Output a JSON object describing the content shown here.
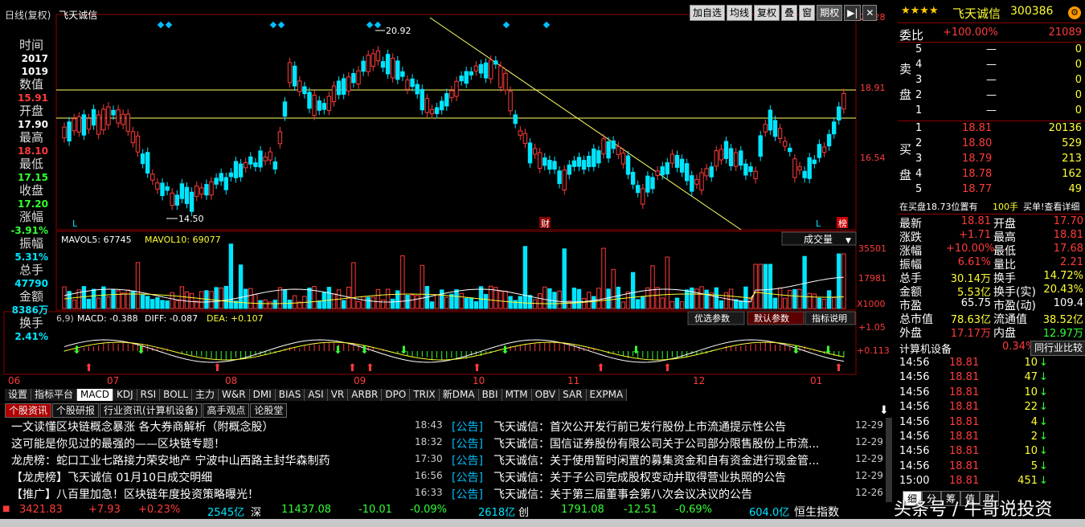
{
  "header": {
    "chart_title": "日线(复权)",
    "stock_name": "飞天诚信",
    "buttons": [
      "加自选",
      "均线",
      "复权",
      "叠",
      "窗"
    ],
    "period_label": "期权"
  },
  "price_axis": {
    "labels": [
      "21.28",
      "18.91",
      "16.54"
    ],
    "high_marker": "20.92",
    "low_marker": "14.50",
    "markers": [
      "L",
      "财",
      "L",
      "榜"
    ]
  },
  "volume": {
    "mavol5": "MAVOL5: 67745",
    "mavol10": "MAVOL10: 69077",
    "dropdown": "成交量",
    "axis": [
      "35501",
      "17981"
    ],
    "unit": "X1000"
  },
  "macd": {
    "params": "6,9)",
    "macd": "MACD: -0.388",
    "diff": "DIFF: -0.087",
    "dea": "DEA: +0.107",
    "axis": [
      "+1.05",
      "+0.113"
    ],
    "buttons": [
      "优选参数",
      "默认参数",
      "指标说明"
    ]
  },
  "months": [
    "06",
    "07",
    "08",
    "09",
    "10",
    "11",
    "12",
    "01"
  ],
  "left_panel": [
    {
      "label": "时间",
      "values": [
        "2017",
        "1019"
      ],
      "color": "#ffffff"
    },
    {
      "label": "数值",
      "values": [
        "15.91"
      ],
      "color": "#ff3b3b"
    },
    {
      "label": "开盘",
      "values": [
        "17.90"
      ],
      "color": "#ffffff"
    },
    {
      "label": "最高",
      "values": [
        "18.10"
      ],
      "color": "#ff3b3b"
    },
    {
      "label": "最低",
      "values": [
        "17.15"
      ],
      "color": "#33ff33"
    },
    {
      "label": "收盘",
      "values": [
        "17.20"
      ],
      "color": "#33ff33"
    },
    {
      "label": "涨幅",
      "values": [
        "-3.91%"
      ],
      "color": "#33ff33"
    },
    {
      "label": "振幅",
      "values": [
        "5.31%"
      ],
      "color": "#00e5ff"
    },
    {
      "label": "总手",
      "values": [
        "47790"
      ],
      "color": "#00e5ff"
    },
    {
      "label": "金额",
      "values": [
        "8386万"
      ],
      "color": "#00e5ff"
    },
    {
      "label": "换手",
      "values": [
        "2.41%"
      ],
      "color": "#00e5ff"
    }
  ],
  "right": {
    "stars": "★★★★",
    "name": "飞天诚信",
    "code": "300386",
    "weibi_label": "委比",
    "weibi": "+100.00%",
    "weicha": "21089",
    "sell_label": [
      "卖",
      "盘"
    ],
    "buy_label": [
      "买",
      "盘"
    ],
    "sell": [
      {
        "n": "5",
        "p": "—",
        "v": "0"
      },
      {
        "n": "4",
        "p": "—",
        "v": "0"
      },
      {
        "n": "3",
        "p": "—",
        "v": "0"
      },
      {
        "n": "2",
        "p": "—",
        "v": "0"
      },
      {
        "n": "1",
        "p": "—",
        "v": "0"
      }
    ],
    "buy": [
      {
        "n": "1",
        "p": "18.81",
        "v": "20136"
      },
      {
        "n": "2",
        "p": "18.80",
        "v": "529"
      },
      {
        "n": "3",
        "p": "18.79",
        "v": "213"
      },
      {
        "n": "4",
        "p": "18.78",
        "v": "162"
      },
      {
        "n": "5",
        "p": "18.77",
        "v": "49"
      }
    ],
    "inbuy": "在买盘18.73位置有",
    "inbuy_qty": "100手",
    "inbuy_link": "买单!查看详细",
    "quote": [
      [
        "最新",
        "18.81",
        "开盘",
        "17.70"
      ],
      [
        "涨跌",
        "+1.71",
        "最高",
        "18.81"
      ],
      [
        "涨幅",
        "+10.00%",
        "最低",
        "17.68"
      ],
      [
        "振幅",
        "6.61%",
        "量比",
        "2.21"
      ],
      [
        "总手",
        "30.14万",
        "换手",
        "14.72%"
      ],
      [
        "金额",
        "5.53亿",
        "换手(实)",
        "20.43%"
      ],
      [
        "市盈",
        "65.75",
        "市盈(动)",
        "109.4"
      ],
      [
        "总市值",
        "78.63亿",
        "流通值",
        "38.52亿"
      ],
      [
        "外盘",
        "17.17万",
        "内盘",
        "12.97万"
      ]
    ],
    "sector": "计算机设备",
    "sector_pct": "0.34%",
    "compare": "同行业比较",
    "ticks": [
      [
        "14:56",
        "18.81",
        "10",
        "↓"
      ],
      [
        "14:56",
        "18.81",
        "47",
        "↓"
      ],
      [
        "14:56",
        "18.81",
        "10",
        "↓"
      ],
      [
        "14:56",
        "18.81",
        "22",
        "↓"
      ],
      [
        "14:56",
        "18.81",
        "4",
        "↓"
      ],
      [
        "14:56",
        "18.81",
        "2",
        "↓"
      ],
      [
        "14:56",
        "18.81",
        "10",
        "↓"
      ],
      [
        "14:56",
        "18.81",
        "5",
        "↓"
      ],
      [
        "15:00",
        "18.81",
        "451",
        "↓"
      ]
    ],
    "bottom_tabs": [
      "细",
      "分",
      "筹",
      "值",
      "财"
    ]
  },
  "tabs": [
    "设置",
    "指标平台",
    "MACD",
    "KDJ",
    "RSI",
    "BOLL",
    "主力",
    "W&R",
    "DMI",
    "BIAS",
    "ASI",
    "VR",
    "ARBR",
    "DPO",
    "TRIX",
    "新DMA",
    "BBI",
    "MTM",
    "OBV",
    "SAR",
    "EXPMA"
  ],
  "news_tabs": [
    "个股资讯",
    "个股研报",
    "行业资讯(计算机设备)",
    "高手观点",
    "论股堂"
  ],
  "news_left": [
    "一文读懂区块链概念暴涨 各大券商解析（附概念股）",
    "这可能是你见过的最强的——区块链专题！",
    "龙虎榜：蛇口工业七路接力荣安地产 宁波中山西路主封华森制药",
    "【龙虎榜】飞天诚信 01月10日成交明细",
    "【推广】八百里加急！区块链年度投资策略曝光！"
  ],
  "news_right": [
    {
      "time": "18:43",
      "tag": "[公告]",
      "text": "飞天诚信：首次公开发行前已发行股份上市流通提示性公告",
      "date": "12-29"
    },
    {
      "time": "18:32",
      "tag": "[公告]",
      "text": "飞天诚信：国信证券股份有限公司关于公司部分限售股份上市流...",
      "date": "12-29"
    },
    {
      "time": "17:30",
      "tag": "[公告]",
      "text": "飞天诚信：关于使用暂时闲置的募集资金和自有资金进行现金管...",
      "date": "12-29"
    },
    {
      "time": "16:56",
      "tag": "[公告]",
      "text": "飞天诚信：关于子公司完成股权变动并取得营业执照的公告",
      "date": "12-29"
    },
    {
      "time": "16:33",
      "tag": "[公告]",
      "text": "飞天诚信：关于第三届董事会第八次会议决议的公告",
      "date": "12-26"
    }
  ],
  "bottom": {
    "sh": "3421.83",
    "sh_chg": "+7.93",
    "sh_pct": "+0.23%",
    "sh_amt": "2545亿",
    "sz_label": "深",
    "sz": "11437.08",
    "sz_chg": "-10.01",
    "sz_pct": "-0.09%",
    "sz_amt": "2618亿",
    "cy_label": "创",
    "cy": "1791.08",
    "cy_chg": "-12.51",
    "cy_pct": "-0.69%",
    "cy_amt": "604.0亿",
    "hs_label": "恒生指数",
    "watermark": "头条号 / 牛哥说投资"
  }
}
